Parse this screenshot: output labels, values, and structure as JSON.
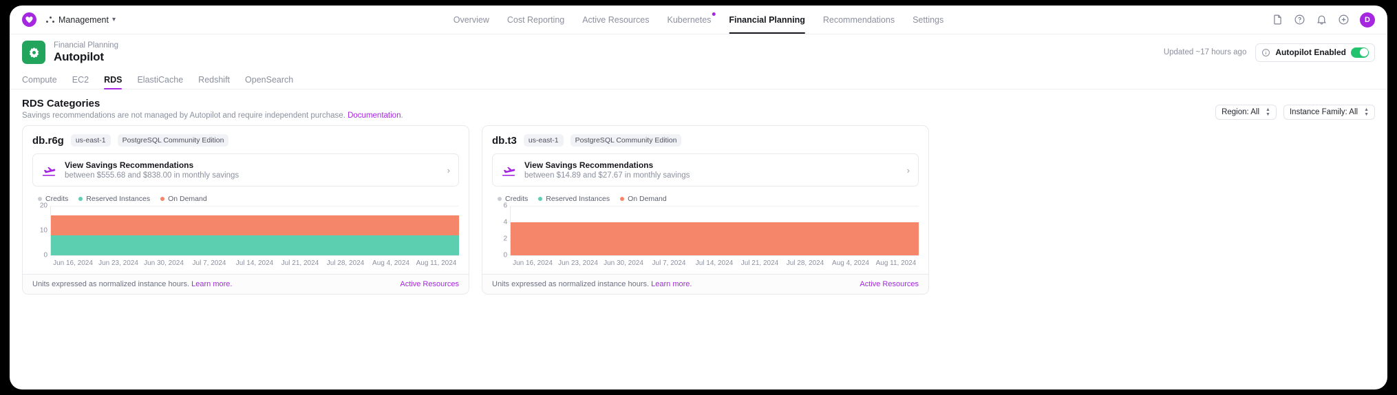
{
  "topnav": {
    "org_label": "Management",
    "tabs": [
      {
        "label": "Overview",
        "active": false,
        "badge": false
      },
      {
        "label": "Cost Reporting",
        "active": false,
        "badge": false
      },
      {
        "label": "Active Resources",
        "active": false,
        "badge": false
      },
      {
        "label": "Kubernetes",
        "active": false,
        "badge": true
      },
      {
        "label": "Financial Planning",
        "active": true,
        "badge": false
      },
      {
        "label": "Recommendations",
        "active": false,
        "badge": false
      },
      {
        "label": "Settings",
        "active": false,
        "badge": false
      }
    ],
    "icons": [
      "document-icon",
      "help-circle-icon",
      "bell-icon",
      "plus-circle-icon"
    ],
    "avatar_initial": "D",
    "accent": "#a527e0"
  },
  "pagehead": {
    "eyebrow": "Financial Planning",
    "title": "Autopilot",
    "updated": "Updated ~17 hours ago",
    "autopilot_label": "Autopilot Enabled",
    "autopilot_on": true,
    "app_icon_color": "#22a45c",
    "toggle_color": "#22c26e"
  },
  "subtabs": [
    {
      "label": "Compute",
      "active": false
    },
    {
      "label": "EC2",
      "active": false
    },
    {
      "label": "RDS",
      "active": true
    },
    {
      "label": "ElastiCache",
      "active": false
    },
    {
      "label": "Redshift",
      "active": false
    },
    {
      "label": "OpenSearch",
      "active": false
    }
  ],
  "section": {
    "title": "RDS Categories",
    "subtitle": "Savings recommendations are not managed by Autopilot and require independent purchase.",
    "doc_link": "Documentation",
    "doc_trailing": ".",
    "filters": [
      {
        "label": "Region: All"
      },
      {
        "label": "Instance Family: All"
      }
    ]
  },
  "cards": [
    {
      "title": "db.r6g",
      "region_chip": "us-east-1",
      "engine_chip": "PostgreSQL Community Edition",
      "savings_title": "View Savings Recommendations",
      "savings_sub": "between $555.68 and $838.00 in monthly savings",
      "footer_note": "Units expressed as normalized instance hours.",
      "footer_link": "Learn more.",
      "footer_action": "Active Resources"
    },
    {
      "title": "db.t3",
      "region_chip": "us-east-1",
      "engine_chip": "PostgreSQL Community Edition",
      "savings_title": "View Savings Recommendations",
      "savings_sub": "between $14.89 and $27.67 in monthly savings",
      "footer_note": "Units expressed as normalized instance hours.",
      "footer_link": "Learn more.",
      "footer_action": "Active Resources"
    }
  ],
  "legend": [
    {
      "label": "Credits",
      "color": "#c9ccd4"
    },
    {
      "label": "Reserved Instances",
      "color": "#5ccfb0"
    },
    {
      "label": "On Demand",
      "color": "#f5866a"
    }
  ],
  "chart_data": [
    {
      "type": "area",
      "title": "db.r6g",
      "xlabel": "",
      "ylabel": "",
      "ylim": [
        0,
        20
      ],
      "yticks": [
        0,
        10,
        20
      ],
      "grid": true,
      "legend_position": "top-left",
      "stacked": true,
      "x": [
        "Jun 16, 2024",
        "Jun 23, 2024",
        "Jun 30, 2024",
        "Jul 7, 2024",
        "Jul 14, 2024",
        "Jul 21, 2024",
        "Jul 28, 2024",
        "Aug 4, 2024",
        "Aug 11, 2024"
      ],
      "series": [
        {
          "name": "Reserved Instances",
          "color": "#5ccfb0",
          "values": [
            8,
            8,
            8,
            8,
            8,
            8,
            8,
            8,
            8
          ]
        },
        {
          "name": "On Demand",
          "color": "#f5866a",
          "values": [
            8,
            8,
            8,
            8,
            8,
            8,
            8,
            8,
            8
          ]
        },
        {
          "name": "Credits",
          "color": "#c9ccd4",
          "values": [
            0,
            0,
            0,
            0,
            0,
            0,
            0,
            0,
            0
          ]
        }
      ]
    },
    {
      "type": "area",
      "title": "db.t3",
      "xlabel": "",
      "ylabel": "",
      "ylim": [
        0,
        6
      ],
      "yticks": [
        0,
        2,
        4,
        6
      ],
      "grid": true,
      "legend_position": "top-left",
      "stacked": true,
      "x": [
        "Jun 16, 2024",
        "Jun 23, 2024",
        "Jun 30, 2024",
        "Jul 7, 2024",
        "Jul 14, 2024",
        "Jul 21, 2024",
        "Jul 28, 2024",
        "Aug 4, 2024",
        "Aug 11, 2024"
      ],
      "series": [
        {
          "name": "Reserved Instances",
          "color": "#5ccfb0",
          "values": [
            0,
            0,
            0,
            0,
            0,
            0,
            0,
            0,
            0
          ]
        },
        {
          "name": "On Demand",
          "color": "#f5866a",
          "values": [
            4,
            4,
            4,
            4,
            4,
            4,
            4,
            4,
            4
          ]
        },
        {
          "name": "Credits",
          "color": "#c9ccd4",
          "values": [
            0,
            0,
            0,
            0,
            0,
            0,
            0,
            0,
            0
          ]
        }
      ]
    }
  ]
}
